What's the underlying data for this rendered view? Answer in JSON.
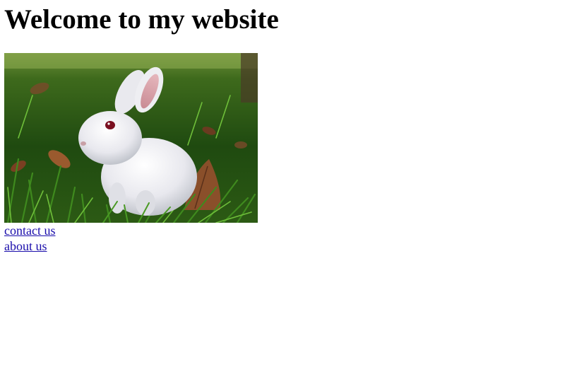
{
  "page": {
    "title": "Welcome to my website"
  },
  "image": {
    "subject": "white-rabbit-in-grass-photo"
  },
  "links": [
    {
      "label": "contact us"
    },
    {
      "label": "about us"
    }
  ],
  "colors": {
    "link": "#1a0dab",
    "heading": "#000000",
    "background": "#ffffff"
  }
}
